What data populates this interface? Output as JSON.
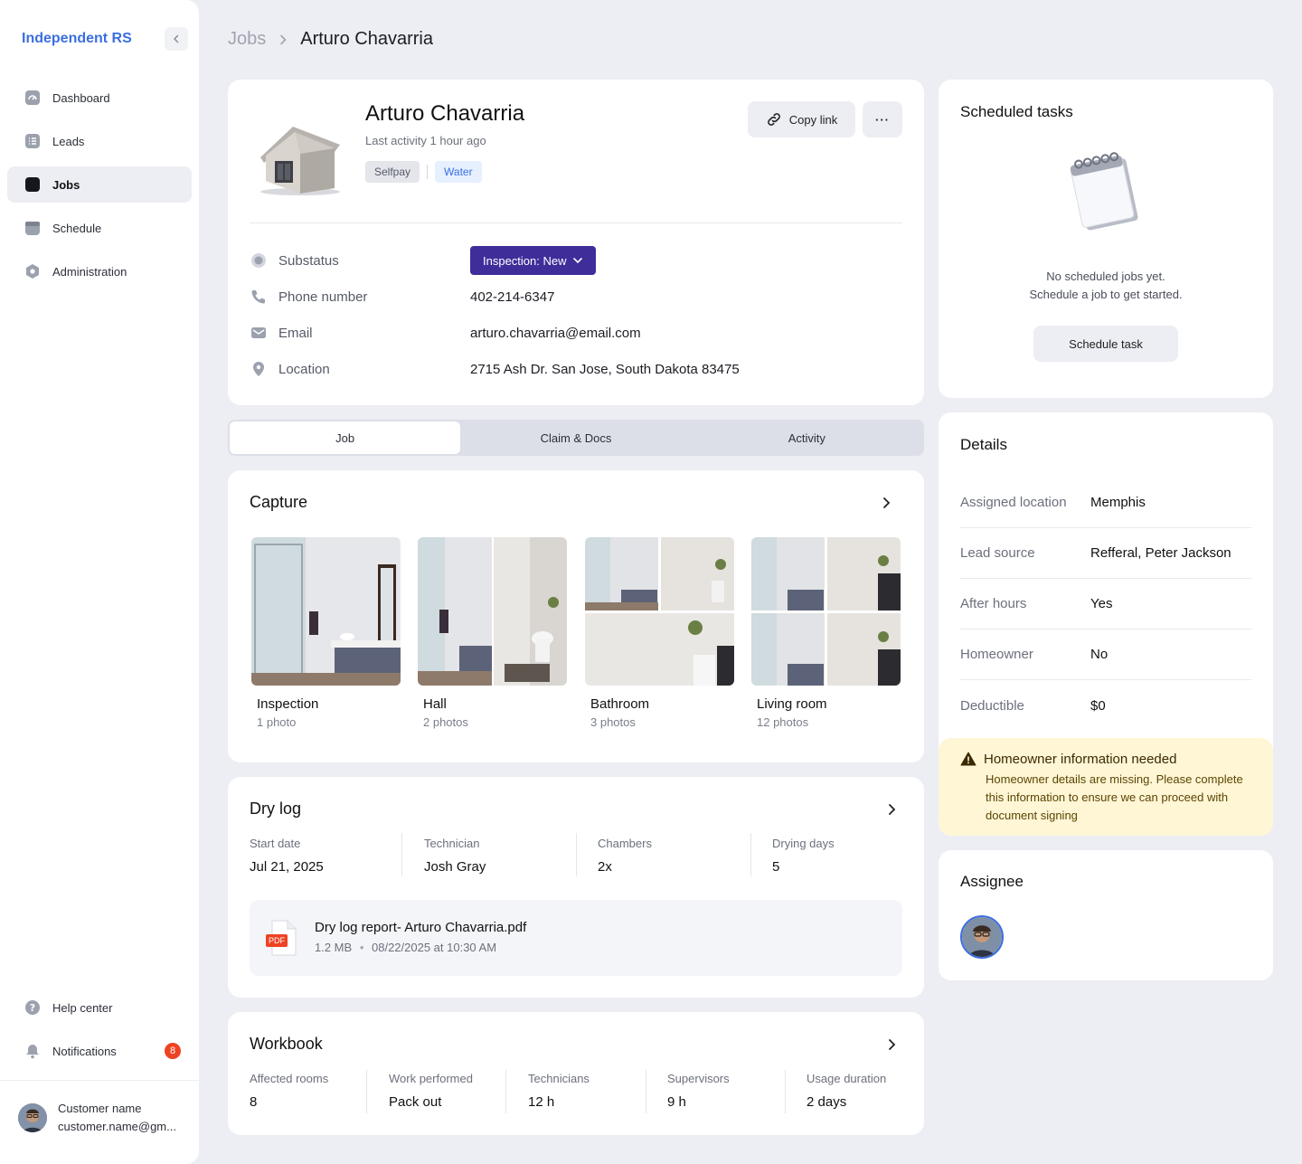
{
  "sidebar": {
    "brand": "Independent RS",
    "items": [
      {
        "label": "Dashboard",
        "icon": "dashboard-icon"
      },
      {
        "label": "Leads",
        "icon": "list-icon"
      },
      {
        "label": "Jobs",
        "icon": "jobs-icon"
      },
      {
        "label": "Schedule",
        "icon": "calendar-icon"
      },
      {
        "label": "Administration",
        "icon": "admin-gear-icon"
      }
    ],
    "bottom": [
      {
        "label": "Help center",
        "icon": "help-icon"
      },
      {
        "label": "Notifications",
        "icon": "bell-icon",
        "badge": "8"
      }
    ],
    "user": {
      "name": "Customer name",
      "email": "customer.name@gm..."
    }
  },
  "breadcrumb": {
    "parent": "Jobs",
    "current": "Arturo Chavarria"
  },
  "header": {
    "name": "Arturo Chavarria",
    "last_activity": "Last activity 1 hour ago",
    "tags": [
      "Selfpay",
      "Water"
    ],
    "copy_link": "Copy link",
    "more": "···"
  },
  "info": {
    "substatus_label": "Substatus",
    "substatus_value": "Inspection: New",
    "phone_label": "Phone number",
    "phone_value": "402-214-6347",
    "email_label": "Email",
    "email_value": "arturo.chavarria@email.com",
    "location_label": "Location",
    "location_value": "2715 Ash Dr. San Jose, South Dakota 83475"
  },
  "tabs": [
    "Job",
    "Claim & Docs",
    "Activity"
  ],
  "capture": {
    "title": "Capture",
    "items": [
      {
        "title": "Inspection",
        "count": "1 photo"
      },
      {
        "title": "Hall",
        "count": "2 photos"
      },
      {
        "title": "Bathroom",
        "count": "3 photos"
      },
      {
        "title": "Living room",
        "count": "12 photos"
      }
    ]
  },
  "drylog": {
    "title": "Dry log",
    "stats": [
      {
        "label": "Start date",
        "value": "Jul 21, 2025"
      },
      {
        "label": "Technician",
        "value": "Josh Gray"
      },
      {
        "label": "Chambers",
        "value": "2x"
      },
      {
        "label": "Drying days",
        "value": "5"
      }
    ],
    "file": {
      "badge": "PDF",
      "name": "Dry log report- Arturo Chavarria.pdf",
      "size": "1.2 MB",
      "date": "08/22/2025 at 10:30 AM"
    }
  },
  "workbook": {
    "title": "Workbook",
    "stats": [
      {
        "label": "Affected rooms",
        "value": "8"
      },
      {
        "label": "Work performed",
        "value": "Pack out"
      },
      {
        "label": "Technicians",
        "value": "12 h"
      },
      {
        "label": "Supervisors",
        "value": "9 h"
      },
      {
        "label": "Usage duration",
        "value": "2 days"
      }
    ]
  },
  "scheduled": {
    "title": "Scheduled tasks",
    "empty_line1": "No scheduled jobs yet.",
    "empty_line2": "Schedule a job to get started.",
    "button": "Schedule task"
  },
  "details": {
    "title": "Details",
    "rows": [
      {
        "label": "Assigned location",
        "value": "Memphis"
      },
      {
        "label": "Lead source",
        "value": "Refferal, Peter Jackson"
      },
      {
        "label": "After hours",
        "value": "Yes"
      },
      {
        "label": "Homeowner",
        "value": "No"
      },
      {
        "label": "Deductible",
        "value": "$0"
      }
    ],
    "warning": {
      "title": "Homeowner information needed",
      "body": "Homeowner details are missing. Please complete this information to ensure we can proceed with document signing"
    }
  },
  "assignee": {
    "title": "Assignee"
  },
  "colors": {
    "brand": "#3B6EE0",
    "substatus": "#3F2D9A",
    "badge": "#EE4322",
    "warning_bg": "#FFF6D6"
  }
}
